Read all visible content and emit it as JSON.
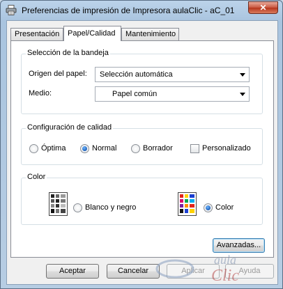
{
  "window": {
    "title": "Preferencias de impresión de Impresora aulaClic - aC_01",
    "close_glyph": "✕"
  },
  "tabs": [
    {
      "label": "Presentación",
      "active": false
    },
    {
      "label": "Papel/Calidad",
      "active": true
    },
    {
      "label": "Mantenimiento",
      "active": false
    }
  ],
  "tray_group": {
    "title": "Selección de la bandeja",
    "source_label": "Origen del papel:",
    "source_value": "Selección automática",
    "media_label": "Medio:",
    "media_value": "Papel común"
  },
  "quality_group": {
    "title": "Configuración de calidad",
    "options": [
      {
        "label": "Óptima",
        "checked": false
      },
      {
        "label": "Normal",
        "checked": true
      },
      {
        "label": "Borrador",
        "checked": false
      }
    ],
    "custom_label": "Personalizado",
    "custom_checked": false
  },
  "color_group": {
    "title": "Color",
    "bw_label": "Blanco y negro",
    "bw_icon": "grayscale-print-icon",
    "color_label": "Color",
    "color_icon": "color-print-icon",
    "color_checked": true
  },
  "buttons": {
    "advanced": "Avanzadas...",
    "accept": "Aceptar",
    "cancel": "Cancelar",
    "apply": "Aplicar",
    "help": "Ayuda"
  },
  "watermark": {
    "line1": "aula",
    "line2": "Clic"
  },
  "colors": {
    "accent_blue": "#1d5fb8",
    "close_red": "#c9573f",
    "group_border": "#d5dfe5"
  }
}
